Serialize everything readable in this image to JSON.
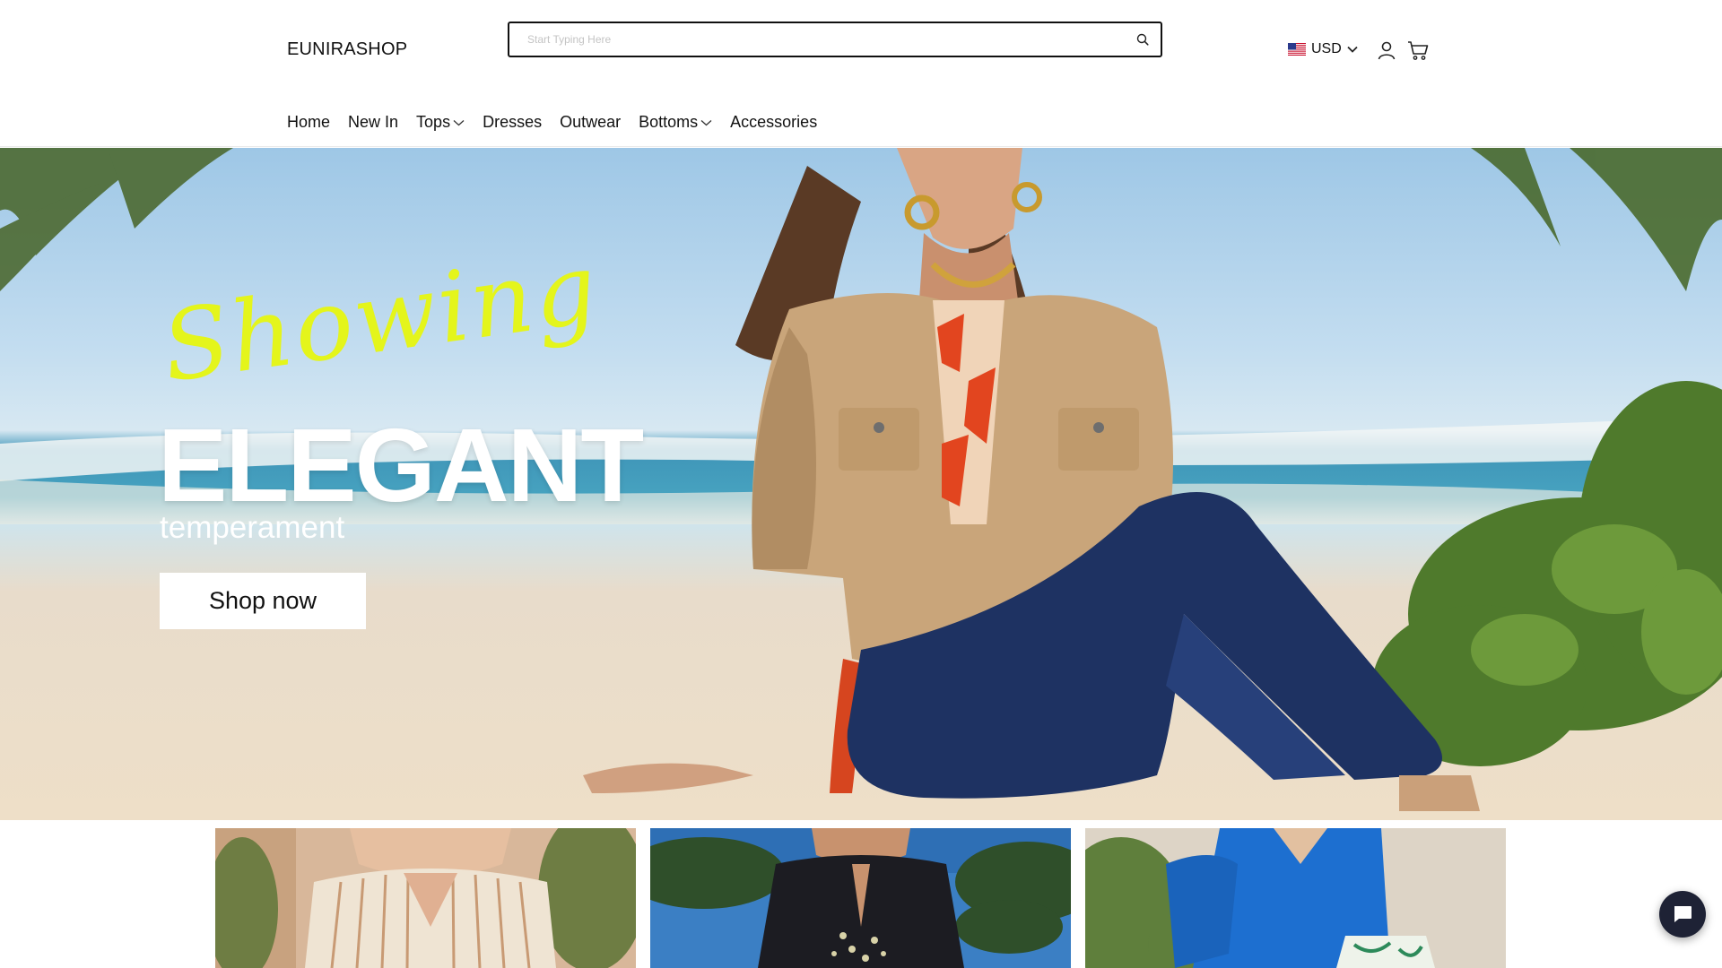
{
  "header": {
    "logo": "EUNIRASHOP",
    "search": {
      "placeholder": "Start Typing Here",
      "value": "",
      "icon": "search-icon"
    },
    "currency": {
      "selected": "USD",
      "flag": "us-flag-icon"
    },
    "icons": [
      "user-icon",
      "cart-icon"
    ]
  },
  "nav": {
    "items": [
      {
        "label": "Home",
        "has_dropdown": false
      },
      {
        "label": "New In",
        "has_dropdown": false
      },
      {
        "label": "Tops",
        "has_dropdown": true
      },
      {
        "label": "Dresses",
        "has_dropdown": false
      },
      {
        "label": "Outwear",
        "has_dropdown": false
      },
      {
        "label": "Bottoms",
        "has_dropdown": true
      },
      {
        "label": "Accessories",
        "has_dropdown": false
      }
    ]
  },
  "hero": {
    "script_text": "Showing",
    "title": "ELEGANT",
    "subtitle": "temperament",
    "cta_label": "Shop now",
    "colors": {
      "script": "#e4f51b",
      "title": "#ffffff"
    }
  },
  "tiles": [
    {
      "name": "striped-shirt-tile"
    },
    {
      "name": "embroidered-black-top-tile"
    },
    {
      "name": "blue-blouse-tile"
    }
  ],
  "chat": {
    "icon": "chat-icon"
  }
}
